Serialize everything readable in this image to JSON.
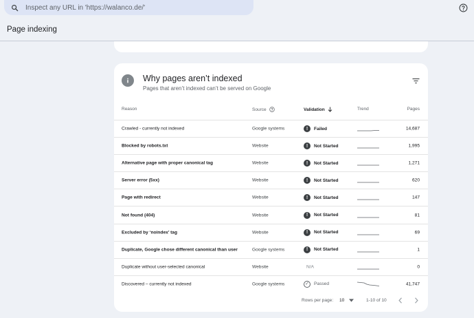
{
  "search": {
    "placeholder": "Inspect any URL in 'https://walanco.de/'"
  },
  "header": {
    "title": "Page indexing"
  },
  "card": {
    "title": "Why pages aren’t indexed",
    "subtitle": "Pages that aren’t indexed can’t be served on Google"
  },
  "table": {
    "headers": {
      "reason": "Reason",
      "source": "Source",
      "validation": "Validation",
      "trend": "Trend",
      "pages": "Pages"
    },
    "rows": [
      {
        "reason": "Crawled - currently not indexed",
        "source": "Google systems",
        "validation": "Failed",
        "pages": "14,687"
      },
      {
        "reason": "Blocked by robots.txt",
        "source": "Website",
        "validation": "Not Started",
        "pages": "1,995"
      },
      {
        "reason": "Alternative page with proper canonical tag",
        "source": "Website",
        "validation": "Not Started",
        "pages": "1,271"
      },
      {
        "reason": "Server error (5xx)",
        "source": "Website",
        "validation": "Not Started",
        "pages": "620"
      },
      {
        "reason": "Page with redirect",
        "source": "Website",
        "validation": "Not Started",
        "pages": "147"
      },
      {
        "reason": "Not found (404)",
        "source": "Website",
        "validation": "Not Started",
        "pages": "81"
      },
      {
        "reason": "Excluded by ‘noindex’ tag",
        "source": "Website",
        "validation": "Not Started",
        "pages": "69"
      },
      {
        "reason": "Duplicate, Google chose different canonical than user",
        "source": "Google systems",
        "validation": "Not Started",
        "pages": "1"
      },
      {
        "reason": "Duplicate without user-selected canonical",
        "source": "Website",
        "validation": "N/A",
        "pages": "0"
      },
      {
        "reason": "Discovered – currently not indexed",
        "source": "Google systems",
        "validation": "Passed",
        "pages": "41,747"
      }
    ]
  },
  "pagination": {
    "rows_per_page_label": "Rows per page:",
    "rows_per_page": "10",
    "range": "1-10 of 10"
  },
  "icons": {
    "search": "search-icon",
    "help": "help-icon",
    "info": "info-icon",
    "filter": "filter-icon"
  }
}
